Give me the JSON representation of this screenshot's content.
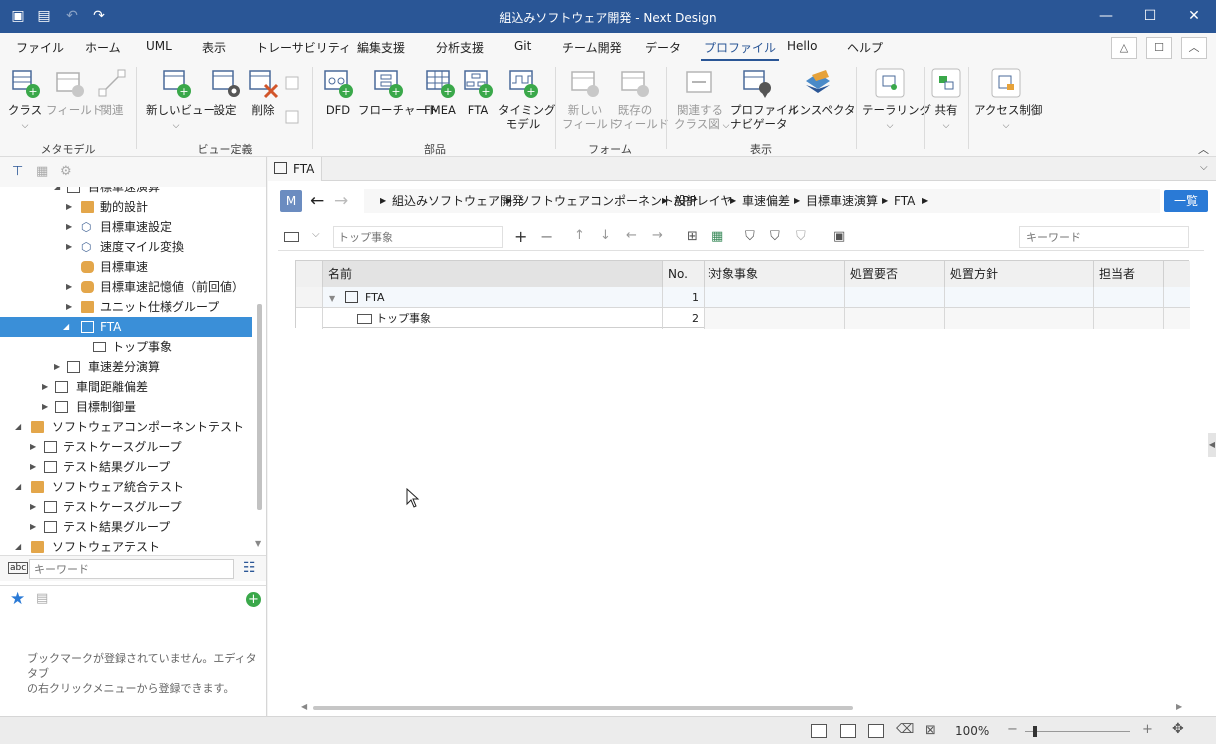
{
  "window": {
    "title": "組込みソフトウェア開発 - Next Design"
  },
  "menu": {
    "items": [
      "ファイル",
      "ホーム",
      "UML",
      "表示",
      "トレーサビリティ",
      "編集支援",
      "分析支援",
      "Git",
      "チーム開発",
      "データ",
      "プロファイル",
      "Hello",
      "ヘルプ"
    ],
    "active": "プロファイル"
  },
  "ribbon": {
    "buttons": [
      "クラス",
      "フィールド",
      "関連",
      "新しいビュー",
      "設定",
      "削除",
      "DFD",
      "フローチャート",
      "FMEA",
      "FTA",
      "タイミング",
      "モデル",
      "新しい",
      "フィールド",
      "既存の",
      "フィールド",
      "関連する",
      "クラス図",
      "プロファイル",
      "ナビゲータ",
      "インスペクタ",
      "テーラリング",
      "共有",
      "アクセス制御"
    ],
    "groups": [
      "メタモデル",
      "ビュー定義",
      "部品",
      "フォーム",
      "表示"
    ]
  },
  "tree": {
    "rows": [
      {
        "label": "目標車速演算"
      },
      {
        "label": "動的設計"
      },
      {
        "label": "目標車速設定"
      },
      {
        "label": "速度マイル変換"
      },
      {
        "label": "目標車速"
      },
      {
        "label": "目標車速記憶値（前回値）"
      },
      {
        "label": "ユニット仕様グループ"
      },
      {
        "label": "FTA"
      },
      {
        "label": "トップ事象"
      },
      {
        "label": "車速差分演算"
      },
      {
        "label": "車間距離偏差"
      },
      {
        "label": "目標制御量"
      },
      {
        "label": "ソフトウェアコンポーネントテスト"
      },
      {
        "label": "テストケースグループ"
      },
      {
        "label": "テスト結果グループ"
      },
      {
        "label": "ソフトウェア統合テスト"
      },
      {
        "label": "テストケースグループ"
      },
      {
        "label": "テスト結果グループ"
      },
      {
        "label": "ソフトウェアテスト"
      }
    ],
    "search_placeholder": "キーワード"
  },
  "bookmarks": {
    "empty_message_1": "ブックマークが登録されていません。エディタタブ",
    "empty_message_2": "の右クリックメニューから登録できます。"
  },
  "editor": {
    "tab": "FTA",
    "m_badge": "M",
    "breadcrumb": [
      "組込みソフトウェア開発",
      "ソフトウェアコンポーネント設計",
      "APPレイヤ",
      "車速偏差",
      "目標車速演算",
      "FTA"
    ],
    "list_button": "一覧",
    "type_placeholder": "トップ事象",
    "keyword_placeholder": "キーワード",
    "columns": [
      "名前",
      "No.",
      "対象事象",
      "処置要否",
      "処置方針",
      "担当者"
    ],
    "rows": [
      {
        "name": "FTA",
        "no": "1"
      },
      {
        "name": "トップ事象",
        "no": "2"
      }
    ]
  },
  "status": {
    "zoom": "100%"
  },
  "colors": {
    "titlebar": "#2a5696",
    "selection": "#3a8fd8",
    "accent": "#2a7ad6"
  }
}
